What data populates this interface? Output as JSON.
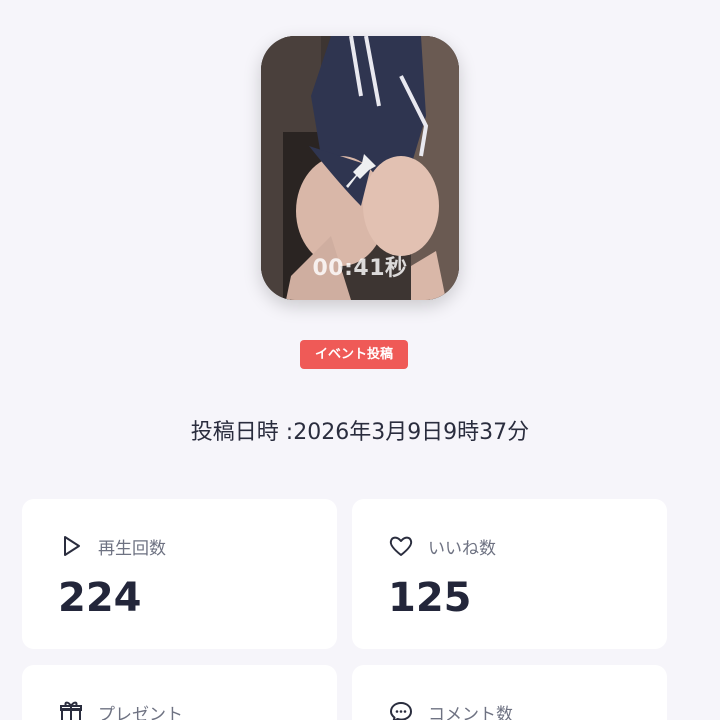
{
  "video": {
    "duration": "00:41秒",
    "pin_icon": "pin-icon"
  },
  "badge": {
    "label": "イベント投稿",
    "color": "#ef5a57"
  },
  "post_date": "投稿日時 :2026年3月9日9時37分",
  "stats": {
    "plays": {
      "label": "再生回数",
      "value": "224",
      "icon": "play-icon"
    },
    "likes": {
      "label": "いいね数",
      "value": "125",
      "icon": "heart-icon"
    },
    "gifts": {
      "label": "プレゼント",
      "icon": "gift-icon"
    },
    "comments": {
      "label": "コメント数",
      "icon": "comment-icon"
    }
  }
}
